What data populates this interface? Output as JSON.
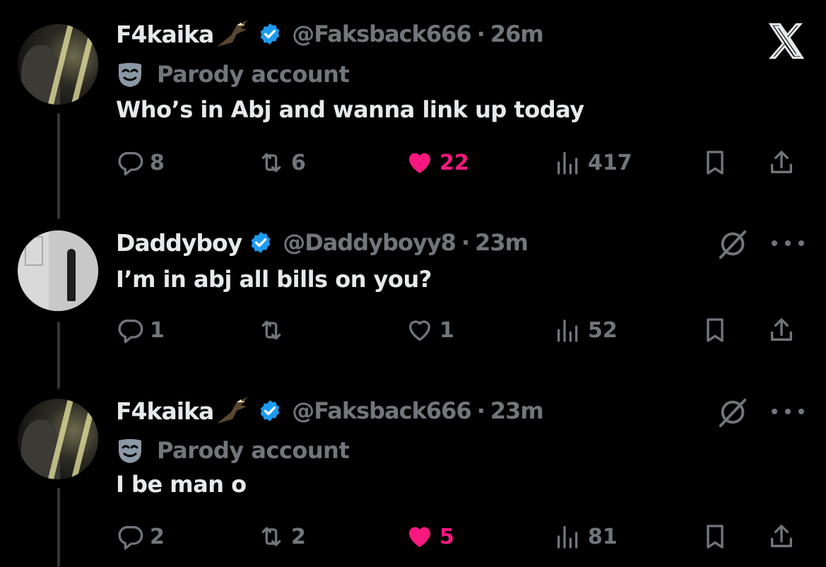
{
  "tweets": [
    {
      "name": "F4kaika",
      "emoji": "eagle-emoji",
      "handle": "@Faksback666",
      "separator": "·",
      "time": "26m",
      "label": "Parody account",
      "text": "Who’s in Abj and wanna link up today",
      "replies": "8",
      "retweets": "6",
      "likes": "22",
      "liked": true,
      "views": "417"
    },
    {
      "name": "Daddyboy",
      "handle": "@Daddyboyy8",
      "separator": "·",
      "time": "23m",
      "text": "I’m in abj all bills on you?",
      "replies": "1",
      "retweets": "",
      "likes": "1",
      "liked": false,
      "views": "52"
    },
    {
      "name": "F4kaika",
      "emoji": "eagle-emoji",
      "handle": "@Faksback666",
      "separator": "·",
      "time": "23m",
      "label": "Parody account",
      "text": "I be man o",
      "replies": "2",
      "retweets": "2",
      "likes": "5",
      "liked": true,
      "views": "81"
    }
  ],
  "colors": {
    "background": "#000000",
    "text": "#e7e9ea",
    "muted": "#71767b",
    "like": "#f91880",
    "verified": "#1d9bf0"
  },
  "icons": [
    "x-logo-icon",
    "verified-badge-icon",
    "parody-mask-icon",
    "reply-icon",
    "retweet-icon",
    "heart-icon",
    "views-icon",
    "bookmark-icon",
    "share-icon",
    "grok-icon",
    "more-icon"
  ]
}
